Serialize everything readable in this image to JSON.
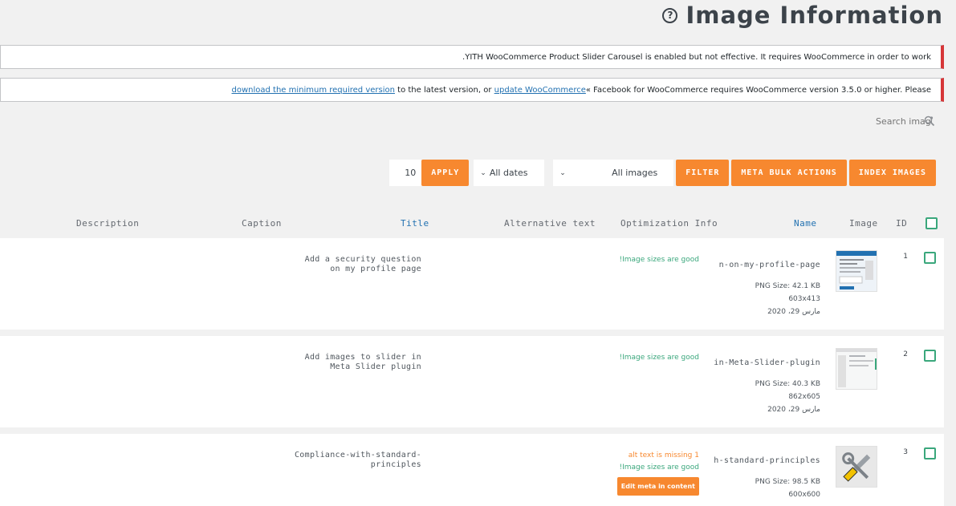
{
  "header": {
    "title": "Image Information",
    "help_icon": "help-circle-icon"
  },
  "notices": {
    "yith": "YITH WooCommerce Product Slider Carousel is enabled but not effective. It requires WooCommerce in order to work.",
    "facebook_prefix": "« Facebook for WooCommerce requires WooCommerce version 3.5.0 or higher. Please ",
    "facebook_link1": "update WooCommerce",
    "facebook_middle": " to the latest version, or ",
    "facebook_link2": "download the minimum required version"
  },
  "search": {
    "placeholder": "Search image",
    "icon": "search-icon"
  },
  "toolbar": {
    "per_page": "10",
    "apply_label": "APPLY",
    "dates_select": "All dates",
    "images_select": "All images",
    "filter_label": "FILTER",
    "meta_bulk_label": "META BULK ACTIONS",
    "index_label": "INDEX IMAGES"
  },
  "table": {
    "columns": {
      "description": "Description",
      "caption": "Caption",
      "title": "Title",
      "alt": "Alternative text",
      "optimization": "Optimization Info",
      "name": "Name",
      "image": "Image",
      "id": "ID"
    },
    "rows": [
      {
        "id": "1",
        "title": "Add a security question on my profile page",
        "optimization": [
          "Image sizes are good!"
        ],
        "file_name": "n-on-my-profile-page",
        "size": "PNG Size: 42.1 KB",
        "dimensions": "603x413",
        "date": "مارس 29، 2020"
      },
      {
        "id": "2",
        "title": "Add images to slider in Meta Slider plugin",
        "optimization": [
          "Image sizes are good!"
        ],
        "file_name": "in-Meta-Slider-plugin",
        "size": "PNG Size: 40.3 KB",
        "dimensions": "862x605",
        "date": "مارس 29، 2020"
      },
      {
        "id": "3",
        "title": "Compliance-with-standard-principles",
        "optimization_warn": "1 alt text is missing",
        "optimization": [
          "Image sizes are good!"
        ],
        "edit_meta": "Edit meta in content",
        "file_name": "h-standard-principles",
        "size": "PNG Size: 98.5 KB",
        "dimensions": "600x600"
      }
    ]
  },
  "colors": {
    "accent": "#f7882f",
    "success": "#3aa77c",
    "link": "#2271b1",
    "error_border": "#d63638"
  }
}
